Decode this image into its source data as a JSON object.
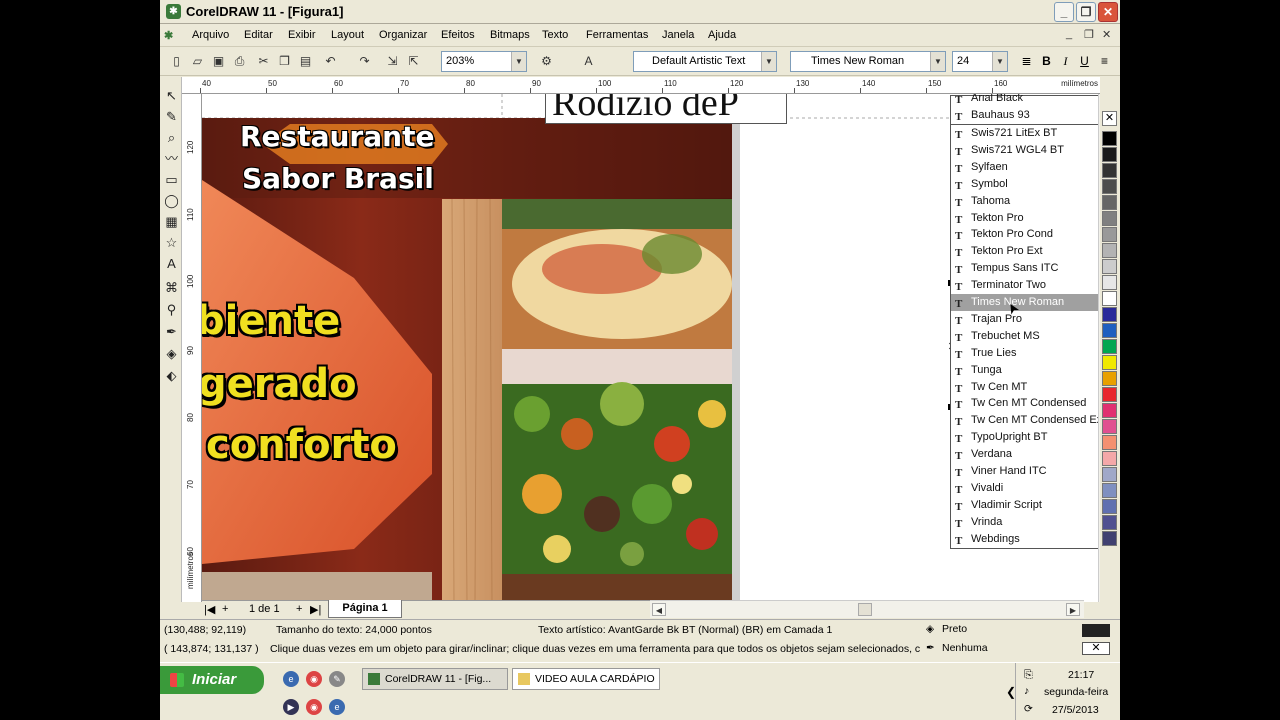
{
  "window": {
    "title": "CorelDRAW 11 - [Figura1]",
    "app_icon": "corel-icon"
  },
  "menu": [
    "Arquivo",
    "Editar",
    "Exibir",
    "Layout",
    "Organizar",
    "Efeitos",
    "Bitmaps",
    "Texto",
    "Ferramentas",
    "Janela",
    "Ajuda"
  ],
  "toolbar": {
    "zoom": "203%",
    "text_style": "Default Artistic Text",
    "font_name": "Times New Roman",
    "font_size": "24",
    "bold": "B",
    "italic": "I",
    "underline": "U"
  },
  "ruler": {
    "h_ticks": [
      "40",
      "50",
      "60",
      "70",
      "80",
      "90",
      "100",
      "110",
      "120",
      "130",
      "140",
      "150",
      "160"
    ],
    "v_ticks": [
      "120",
      "110",
      "100",
      "90",
      "80",
      "70",
      "60"
    ],
    "unit": "milímetros"
  },
  "document": {
    "title_line1": "Restaurante",
    "title_line2": "Sabor Brasil",
    "slogan1": "biente",
    "slogan2": "gerado",
    "slogan3": "conforto",
    "header_text": "Rodízio deP",
    "side_text": "de"
  },
  "font_list": {
    "top_items": [
      "Arial Black",
      "Bauhaus 93"
    ],
    "items": [
      "Swis721 LitEx BT",
      "Swis721 WGL4 BT",
      "Sylfaen",
      "Symbol",
      "Tahoma",
      "Tekton Pro",
      "Tekton Pro Cond",
      "Tekton Pro Ext",
      "Tempus Sans ITC",
      "Terminator Two",
      "Times New Roman",
      "Trajan Pro",
      "Trebuchet MS",
      "True Lies",
      "Tunga",
      "Tw Cen MT",
      "Tw Cen MT Condensed",
      "Tw Cen MT Condensed Extra Bold",
      "TypoUpright BT",
      "Verdana",
      "Viner Hand ITC",
      "Vivaldi",
      "Vladimir Script",
      "Vrinda",
      "Webdings"
    ],
    "selected": "Times New Roman"
  },
  "pagebar": {
    "page_count": "1 de 1",
    "page_tab": "Página 1"
  },
  "status": {
    "coords1": "(130,488; 92,119)",
    "text_size": "Tamanho do texto: 24,000 pontos",
    "object_info": "Texto artístico: AvantGarde Bk BT (Normal) (BR) em Camada 1",
    "fill": "Preto",
    "coords2": "( 143,874; 131,137 )",
    "hint": "Clique duas vezes em um objeto para girar/inclinar; clique duas vezes em uma ferramenta para que todos os objetos sejam selecionados, clique c...",
    "outline": "Nenhuma"
  },
  "taskbar": {
    "start": "Iniciar",
    "tasks": [
      "CorelDRAW 11 - [Fig...",
      "VIDEO AULA CARDÁPIO"
    ],
    "time": "21:17",
    "day": "segunda-feira",
    "date": "27/5/2013"
  },
  "palette_colors": [
    "#000000",
    "#1a1a1a",
    "#333333",
    "#4d4d4d",
    "#666666",
    "#808080",
    "#999999",
    "#b3b3b3",
    "#cccccc",
    "#e6e6e6",
    "#ffffff",
    "#2a2a9a",
    "#1f5fbf",
    "#00a650",
    "#f0e800",
    "#e8a000",
    "#e8272c",
    "#e03070",
    "#e05090",
    "#f49070",
    "#f4a8a8",
    "#a0a8c8",
    "#8090c0",
    "#6070b0",
    "#505090",
    "#404070"
  ]
}
